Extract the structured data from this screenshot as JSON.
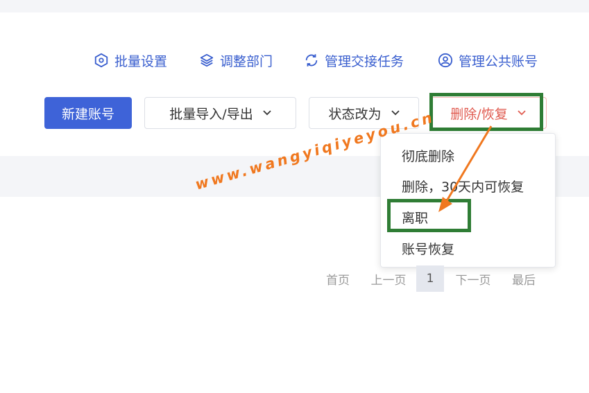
{
  "toolbar_links": {
    "batch_settings": "批量设置",
    "adjust_department": "调整部门",
    "manage_handover": "管理交接任务",
    "manage_public_account": "管理公共账号"
  },
  "buttons": {
    "new_account": "新建账号",
    "batch_import_export": "批量导入/导出",
    "change_status": "状态改为",
    "delete_restore": "删除/恢复"
  },
  "dropdown": {
    "items": [
      "彻底删除",
      "删除，30天内可恢复",
      "离职",
      "账号恢复"
    ]
  },
  "pagination": {
    "first": "首页",
    "prev": "上一页",
    "current": "1",
    "next": "下一页",
    "last": "最后"
  },
  "watermark": {
    "text": "www.wangyiqiyeyou.cn"
  },
  "colors": {
    "accent": "#3e63d8",
    "link": "#3a5fcf",
    "danger": "#e05a4f",
    "highlight": "#2f7d35",
    "annotation": "#f0781f"
  }
}
